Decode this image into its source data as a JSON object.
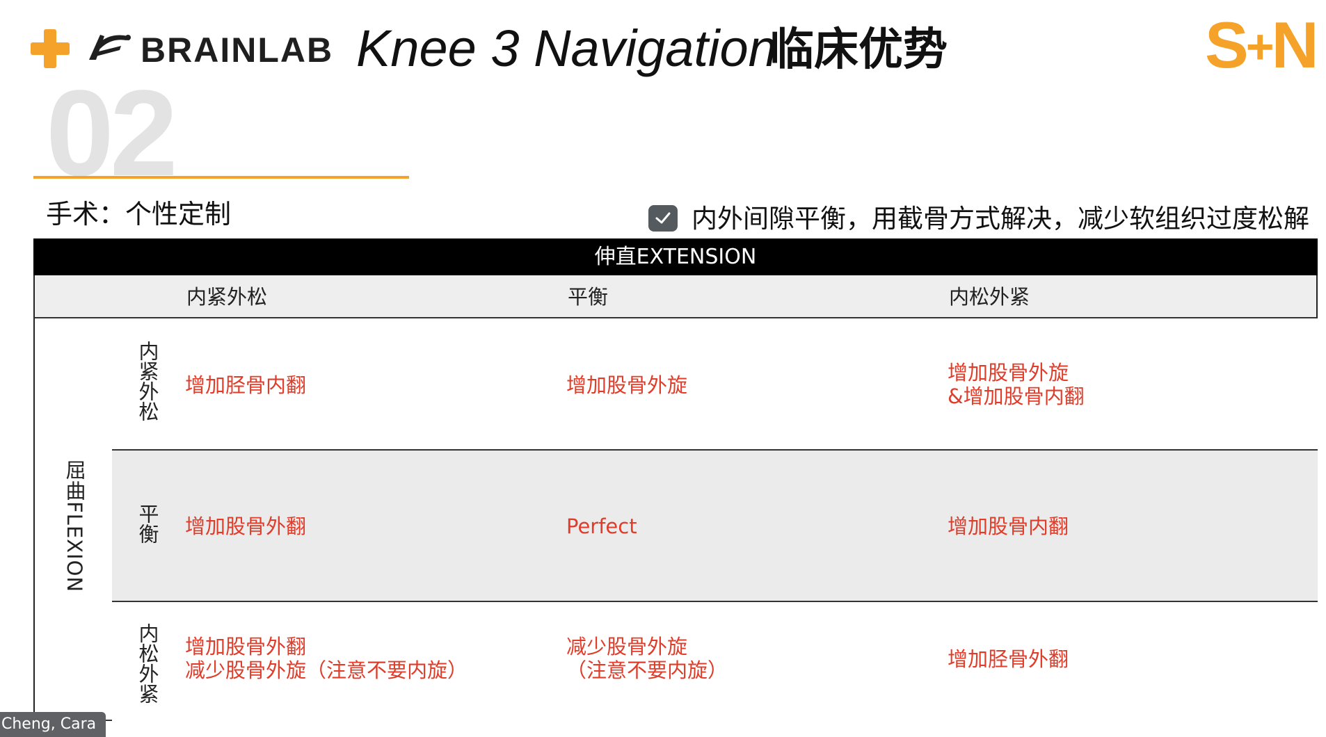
{
  "header": {
    "brand_text": "BRAINLAB",
    "title_en": "Knee 3 Navigation",
    "title_cn": "临床优势",
    "right_logo_text": "SN"
  },
  "section": {
    "number": "02",
    "subtitle": "手术：个性定制"
  },
  "note": {
    "text": "内外间隙平衡，用截骨方式解决，减少软组织过度松解",
    "checked": true
  },
  "table": {
    "extension_header": "伸直EXTENSION",
    "flexion_label": "屈曲FLEXION",
    "columns": [
      "内紧外松",
      "平衡",
      "内松外紧"
    ],
    "rows": [
      {
        "label": "内紧外松",
        "cells": [
          "增加胫骨内翻",
          "增加股骨外旋",
          "增加股骨外旋\n&增加股骨内翻"
        ]
      },
      {
        "label": "平衡",
        "cells": [
          "增加股骨外翻",
          "Perfect",
          "增加股骨内翻"
        ]
      },
      {
        "label": "内松外紧",
        "cells": [
          "增加股骨外翻\n减少股骨外旋（注意不要内旋）",
          "减少股骨外旋\n（注意不要内旋）",
          "增加胫骨外翻"
        ]
      }
    ],
    "text_color": "#e03c2a"
  },
  "user_label": "Cheng, Cara",
  "colors": {
    "accent": "#f5a22a",
    "header_bg": "#000000"
  }
}
